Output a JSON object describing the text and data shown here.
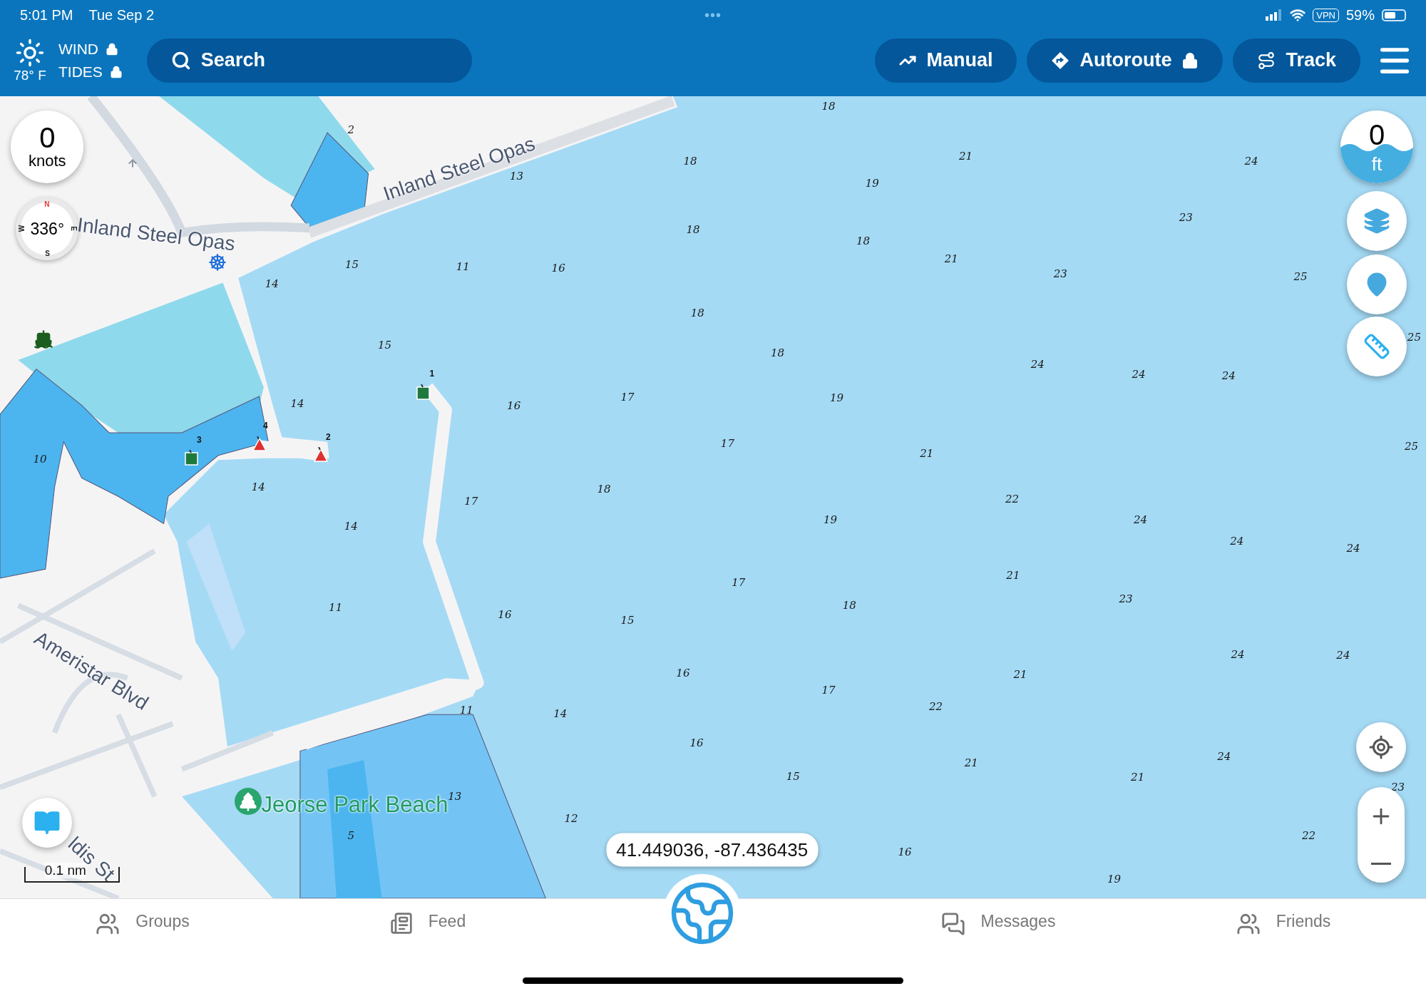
{
  "status_bar": {
    "time": "5:01 PM",
    "date": "Tue Sep 2",
    "dots": "•••",
    "vpn": "VPN",
    "battery": "59%"
  },
  "toolbar": {
    "temperature": "78° F",
    "weather": [
      {
        "label": "WIND",
        "locked": true
      },
      {
        "label": "TIDES",
        "locked": true
      }
    ],
    "search": {
      "placeholder": "Search"
    },
    "buttons": [
      {
        "kind": "manual",
        "label": "Manual",
        "locked": false
      },
      {
        "kind": "autoroute",
        "label": "Autoroute",
        "locked": true
      },
      {
        "kind": "track",
        "label": "Track",
        "locked": false
      }
    ]
  },
  "map": {
    "speed": {
      "value": "0",
      "unit": "knots"
    },
    "compass": {
      "heading": "336°",
      "n": "N",
      "s": "S",
      "e": "E",
      "w": "W"
    },
    "depth": {
      "value": "0",
      "unit": "ft"
    },
    "scale": "0.1 nm",
    "coordinates": "41.449036, -87.436435",
    "labels": [
      {
        "kind": "road",
        "text": "Inland Steel Opas"
      },
      {
        "kind": "road",
        "text": "Inland Steel Opas"
      },
      {
        "kind": "road",
        "text": "Ameristar Blvd"
      },
      {
        "kind": "road",
        "text": "ldis St"
      },
      {
        "kind": "park",
        "text": "Jeorse Park Beach"
      }
    ],
    "markers": [
      {
        "kind": "can",
        "number": "1"
      },
      {
        "kind": "nun",
        "number": "2"
      },
      {
        "kind": "can",
        "number": "3"
      },
      {
        "kind": "nun",
        "number": "4"
      }
    ],
    "soundings": [
      "18",
      "2",
      "13",
      "18",
      "21",
      "19",
      "24",
      "23",
      "18",
      "18",
      "21",
      "23",
      "25",
      "15",
      "11",
      "16",
      "14",
      "18",
      "15",
      "18",
      "24",
      "24",
      "24",
      "25",
      "16",
      "17",
      "19",
      "14",
      "10",
      "17",
      "21",
      "25",
      "14",
      "18",
      "17",
      "22",
      "14",
      "19",
      "24",
      "24",
      "24",
      "21",
      "17",
      "11",
      "16",
      "15",
      "18",
      "23",
      "24",
      "24",
      "16",
      "21",
      "17",
      "22",
      "11",
      "14",
      "16",
      "24",
      "21",
      "15",
      "21",
      "23",
      "13",
      "5",
      "12",
      "16",
      "22",
      "19"
    ]
  },
  "tabs": [
    {
      "kind": "groups",
      "label": "Groups"
    },
    {
      "kind": "feed",
      "label": "Feed"
    },
    {
      "kind": "globe"
    },
    {
      "kind": "messages",
      "label": "Messages"
    },
    {
      "kind": "friends",
      "label": "Friends"
    }
  ]
}
